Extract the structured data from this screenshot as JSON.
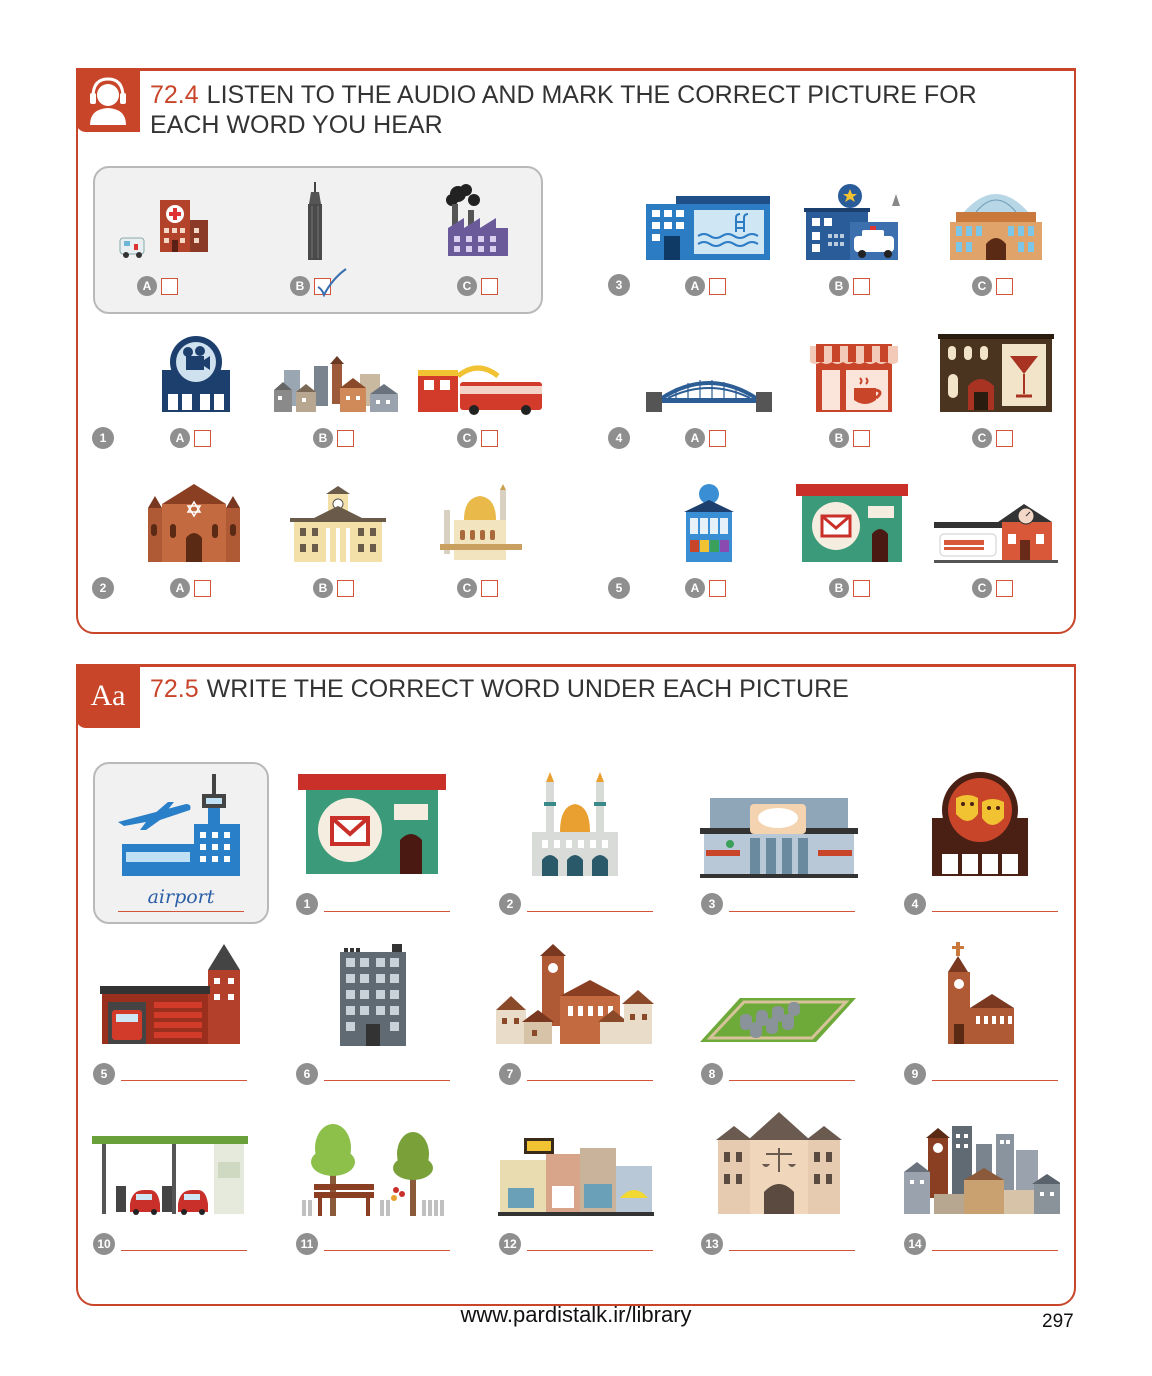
{
  "ex1": {
    "number": "72.4",
    "instruction": "LISTEN TO THE AUDIO AND MARK THE CORRECT PICTURE FOR EACH WORD YOU HEAR",
    "icon": "headphones-person-icon",
    "option_letters": [
      "A",
      "B",
      "C"
    ],
    "example": {
      "pictures": [
        "hospital-icon",
        "skyscraper-icon",
        "factory-icon"
      ],
      "checked": "B"
    },
    "rows": [
      {
        "number": "1",
        "pictures": [
          "cinema-icon",
          "town-icon",
          "bus-station-icon"
        ]
      },
      {
        "number": "2",
        "pictures": [
          "synagogue-icon",
          "town-hall-icon",
          "mosque-icon"
        ]
      },
      {
        "number": "3",
        "pictures": [
          "swimming-pool-icon",
          "police-station-icon",
          "concert-hall-icon"
        ]
      },
      {
        "number": "4",
        "pictures": [
          "bridge-icon",
          "cafe-icon",
          "bar-icon"
        ]
      },
      {
        "number": "5",
        "pictures": [
          "kiosk-icon",
          "post-office-icon",
          "train-station-icon"
        ]
      }
    ]
  },
  "ex2": {
    "number": "72.5",
    "instruction": "WRITE THE CORRECT WORD UNDER EACH PICTURE",
    "badge": "Aa",
    "example_answer": "airport",
    "items": [
      "1",
      "2",
      "3",
      "4",
      "5",
      "6",
      "7",
      "8",
      "9",
      "10",
      "11",
      "12",
      "13",
      "14"
    ]
  },
  "footer": {
    "url": "www.pardistalk.ir/library",
    "page_number": "297"
  },
  "colors": {
    "accent": "#c9452a",
    "number_circle": "#8f8f8f"
  }
}
